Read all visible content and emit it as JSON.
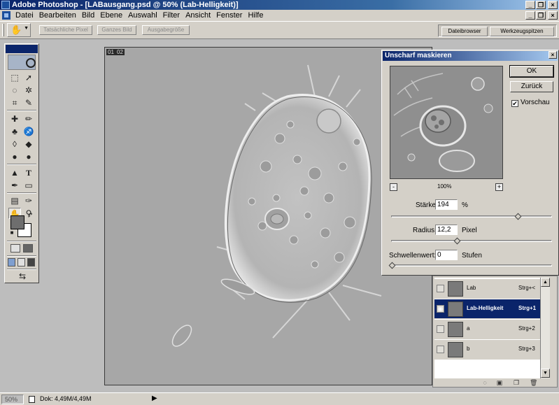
{
  "window": {
    "title": "Adobe Photoshop - [LABausgang.psd @ 50% (Lab-Helligkeit)]",
    "controls": [
      "_",
      "❐",
      "×"
    ]
  },
  "menu": {
    "items": [
      "Datei",
      "Bearbeiten",
      "Bild",
      "Ebene",
      "Auswahl",
      "Filter",
      "Ansicht",
      "Fenster",
      "Hilfe"
    ]
  },
  "options_bar": {
    "buttons": [
      "Tatsächliche Pixel",
      "Ganzes Bild",
      "Ausgabegröße"
    ],
    "palette_tabs": [
      "Dateibrowser",
      "Werkzeugspitzen"
    ]
  },
  "document": {
    "tags": [
      "01",
      "02"
    ]
  },
  "dialog": {
    "title": "Unscharf maskieren",
    "close": "×",
    "ok_label": "OK",
    "reset_label": "Zurück",
    "preview_label": "Vorschau",
    "preview_checked": true,
    "preview_zoom": "100%",
    "zoom_out": "-",
    "zoom_in": "+",
    "amount": {
      "label": "Stärke:",
      "value": "194",
      "unit": "%",
      "fraction": 0.79
    },
    "radius": {
      "label": "Radius:",
      "value": "12,2",
      "unit": "Pixel",
      "fraction": 0.41
    },
    "threshold": {
      "label": "Schwellenwert:",
      "value": "0",
      "unit": "Stufen",
      "fraction": 0.0
    }
  },
  "layers": {
    "rows": [
      {
        "name": "Lab",
        "shortcut": "Strg+<",
        "visible": false,
        "selected": false
      },
      {
        "name": "Lab-Helligkeit",
        "shortcut": "Strg+1",
        "visible": true,
        "selected": true
      },
      {
        "name": "a",
        "shortcut": "Strg+2",
        "visible": false,
        "selected": false
      },
      {
        "name": "b",
        "shortcut": "Strg+3",
        "visible": false,
        "selected": false
      }
    ]
  },
  "status": {
    "zoom": "50%",
    "doc_info": "Dok: 4,49M/4,49M"
  },
  "colors": {
    "titlebar": "#0a246a",
    "foreground_color": "#6e6e6e",
    "background_color": "#ffffff"
  }
}
